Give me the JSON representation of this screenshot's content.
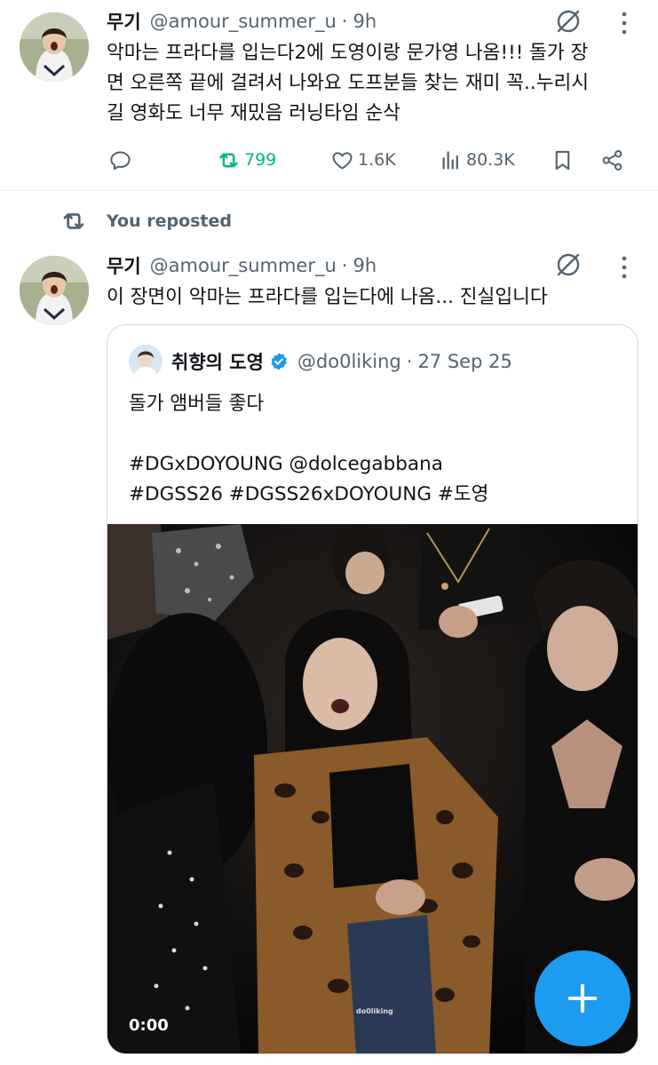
{
  "tweet1": {
    "name": "무기",
    "handle": "@amour_summer_u",
    "separator": "·",
    "time": "9h",
    "text_lines": [
      "악마는 프라다를 입는다2에 도영이랑 문가영 나옴!!! 돌가 장",
      "면 오른쪽 끝에 걸려서 나와요 도프분들 찾는 재미 꼭..누리시",
      "길 영화도 너무 재밌음 러닝타임 순삭"
    ],
    "retweets": "799",
    "likes": "1.6K",
    "views": "80.3K"
  },
  "repost_label": "You reposted",
  "tweet2": {
    "name": "무기",
    "handle": "@amour_summer_u",
    "separator": "·",
    "time": "9h",
    "text": "이 장면이 악마는 프라다를 입는다에 나옴... 진실입니다"
  },
  "quote": {
    "name": "취향의 도영",
    "handle": "@do0liking",
    "separator": "·",
    "date": "27 Sep 25",
    "text_lines": [
      "돌가 앰버들 좋다",
      "",
      "#DGxDOYOUNG @dolcegabbana",
      "#DGSS26 #DGSS26xDOYOUNG #도영"
    ],
    "video_time": "0:00",
    "watermark": "do0liking"
  },
  "colors": {
    "primary_text": "#0f1419",
    "secondary_text": "#536471",
    "retweet_green": "#00ba7c",
    "verified_blue": "#1d9bf0",
    "fab_blue": "#1d9bf0",
    "border": "#cfd9de"
  },
  "icons": [
    "reply-icon",
    "retweet-icon",
    "like-icon",
    "views-icon",
    "bookmark-icon",
    "share-icon",
    "grok-icon",
    "more-icon",
    "verified-icon",
    "compose-plus-icon"
  ]
}
